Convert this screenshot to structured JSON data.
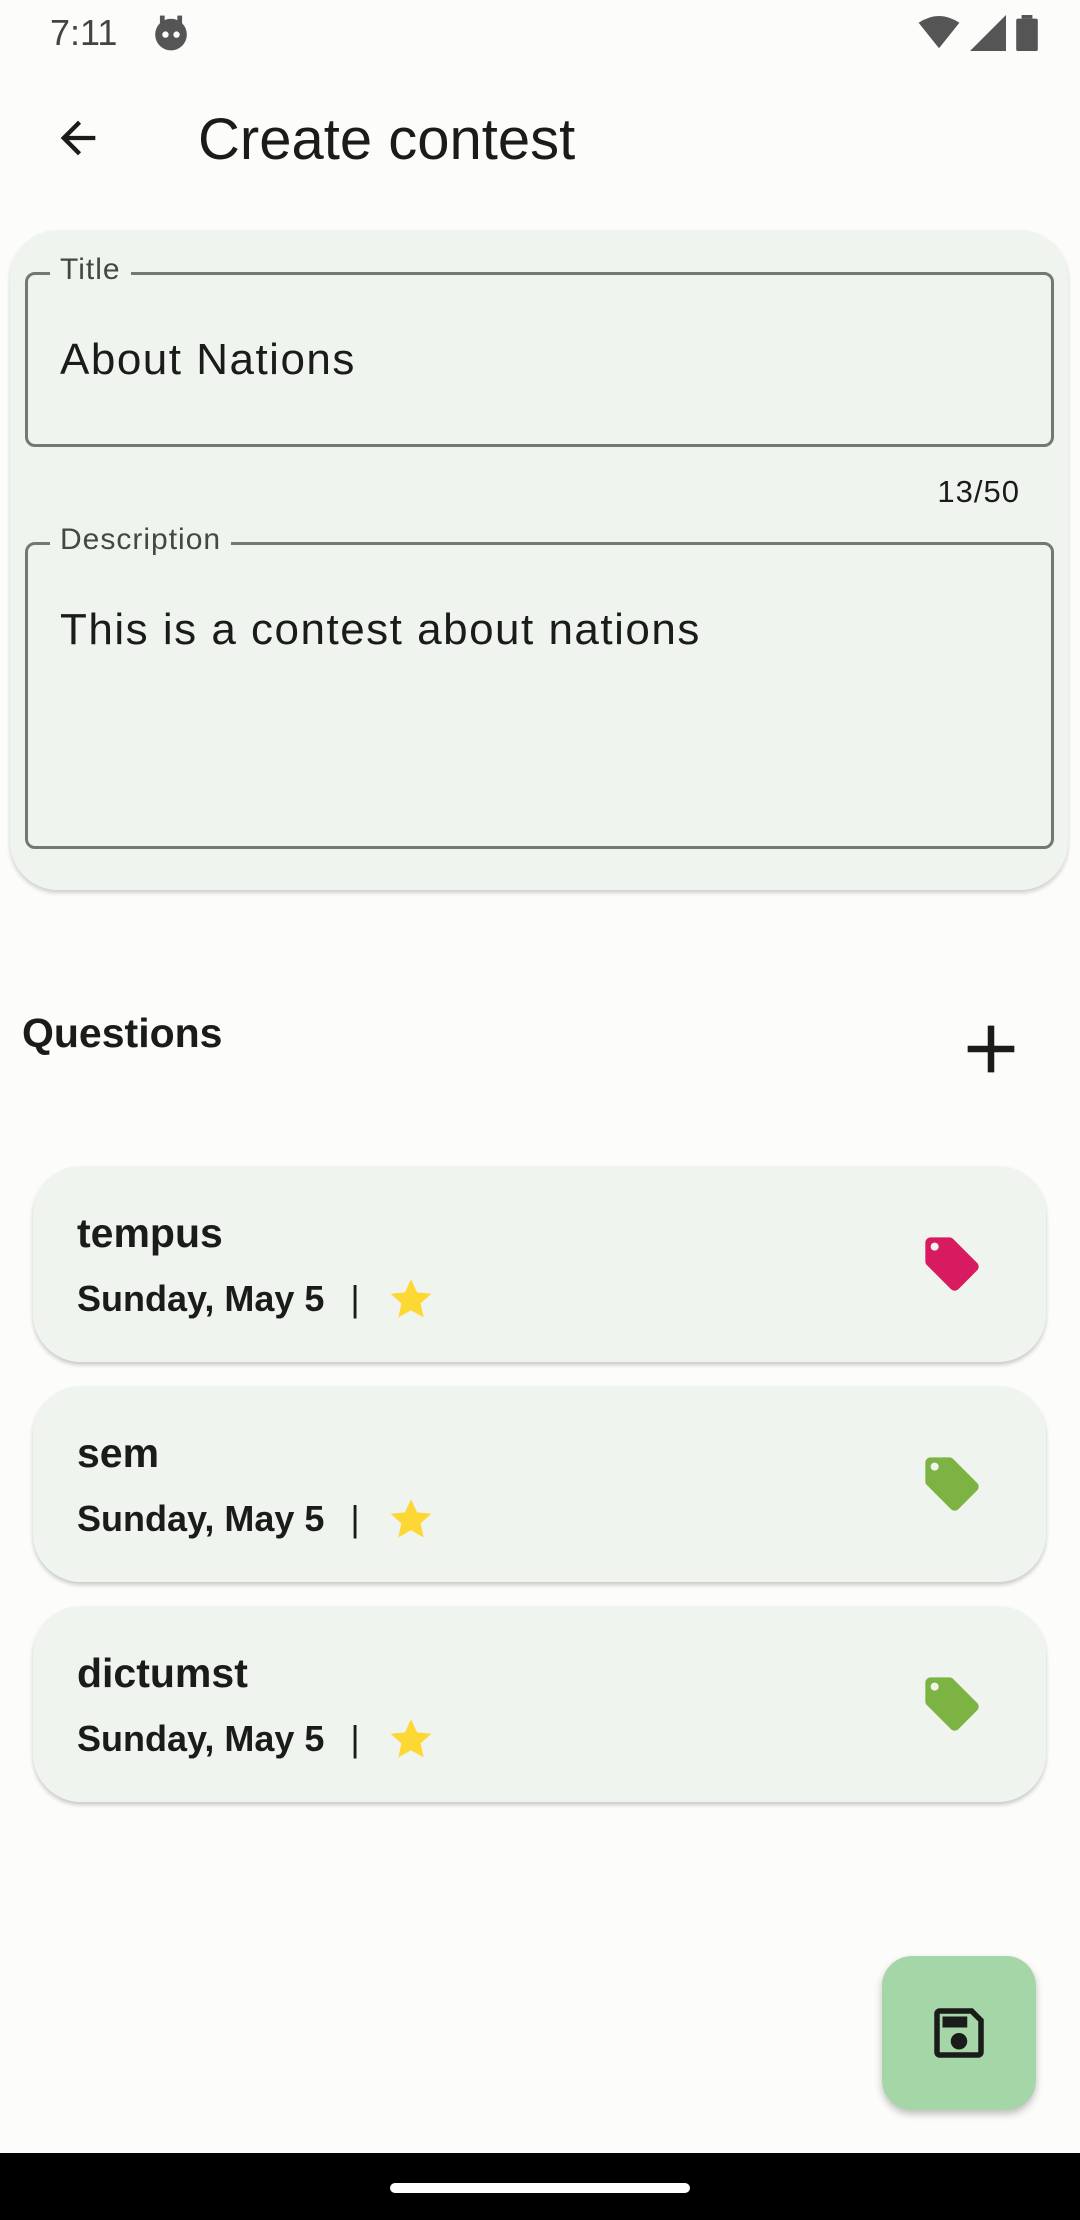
{
  "status_bar": {
    "time": "7:11",
    "icons": [
      "robot-icon",
      "wifi-icon",
      "signal-icon",
      "battery-icon"
    ]
  },
  "app_bar": {
    "back_icon": "arrow-back-icon",
    "title": "Create contest"
  },
  "form": {
    "title_field": {
      "label": "Title",
      "value": "About Nations",
      "counter": "13/50"
    },
    "description_field": {
      "label": "Description",
      "value": "This is a contest about nations"
    }
  },
  "questions": {
    "header": "Questions",
    "add_icon": "plus-icon",
    "items": [
      {
        "title": "tempus",
        "date": "Sunday, May 5",
        "separator": "|",
        "star_icon": "star-icon",
        "tag_icon": "tag-icon",
        "tag_color": "#d81b60"
      },
      {
        "title": "sem",
        "date": "Sunday, May 5",
        "separator": "|",
        "star_icon": "star-icon",
        "tag_icon": "tag-icon",
        "tag_color": "#7cb342"
      },
      {
        "title": "dictumst",
        "date": "Sunday, May 5",
        "separator": "|",
        "star_icon": "star-icon",
        "tag_icon": "tag-icon",
        "tag_color": "#7cb342"
      }
    ]
  },
  "fab": {
    "icon": "save-icon",
    "color": "#a5d6a7"
  },
  "colors": {
    "background": "#fcfdfb",
    "card": "#f0f4ef",
    "star": "#fdd835"
  }
}
